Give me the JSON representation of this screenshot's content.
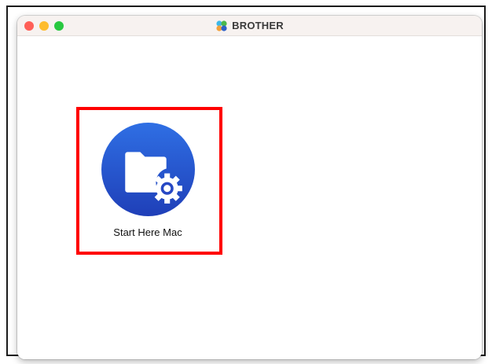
{
  "window": {
    "title": "BROTHER",
    "title_icon": "brother-logo-icon"
  },
  "items": [
    {
      "label": "Start Here Mac",
      "icon": "folder-gear-icon"
    }
  ],
  "colors": {
    "icon_gradient_top": "#2f6fe4",
    "icon_gradient_bottom": "#1f3fb8",
    "highlight": "#ff0000"
  }
}
